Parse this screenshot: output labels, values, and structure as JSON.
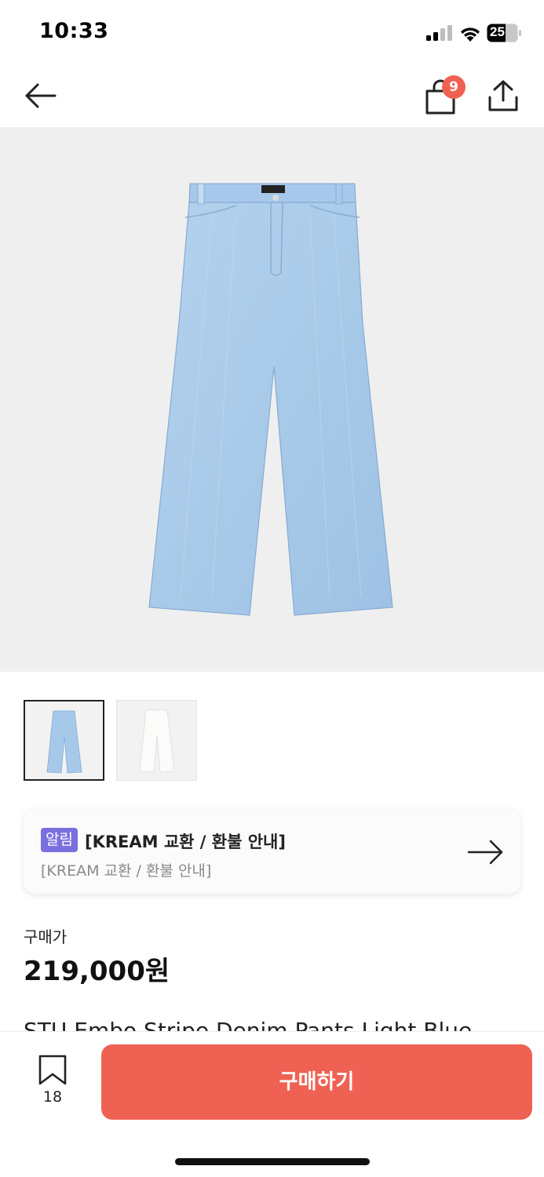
{
  "status_bar": {
    "time": "10:33",
    "battery_level": "25",
    "signal_icon": "cellular-signal-icon",
    "wifi_icon": "wifi-icon",
    "battery_icon": "battery-icon"
  },
  "nav": {
    "back_icon": "back-arrow-icon",
    "cart_icon": "shopping-bag-icon",
    "cart_count": "9",
    "share_icon": "share-icon"
  },
  "product": {
    "image_icon": "denim-pants-image",
    "thumbnails": [
      {
        "name": "light-blue-pants-thumbnail",
        "selected": true
      },
      {
        "name": "white-pants-thumbnail",
        "selected": false
      }
    ],
    "price_label": "구매가",
    "price": "219,000원",
    "name": "STU Embo Stripe Denim Pants Light Blue"
  },
  "notice": {
    "tag": "알림",
    "title": "[KREAM 교환 / 환불 안내]",
    "subtitle": "[KREAM 교환 / 환불 안내]",
    "arrow_icon": "arrow-right-icon"
  },
  "bottom": {
    "bookmark_icon": "bookmark-icon",
    "bookmark_count": "18",
    "buy_label": "구매하기"
  },
  "colors": {
    "accent": "#ef6253",
    "tag": "#7b6fe0",
    "hero_bg": "#efeff0",
    "denim": "#a7c9e9"
  }
}
